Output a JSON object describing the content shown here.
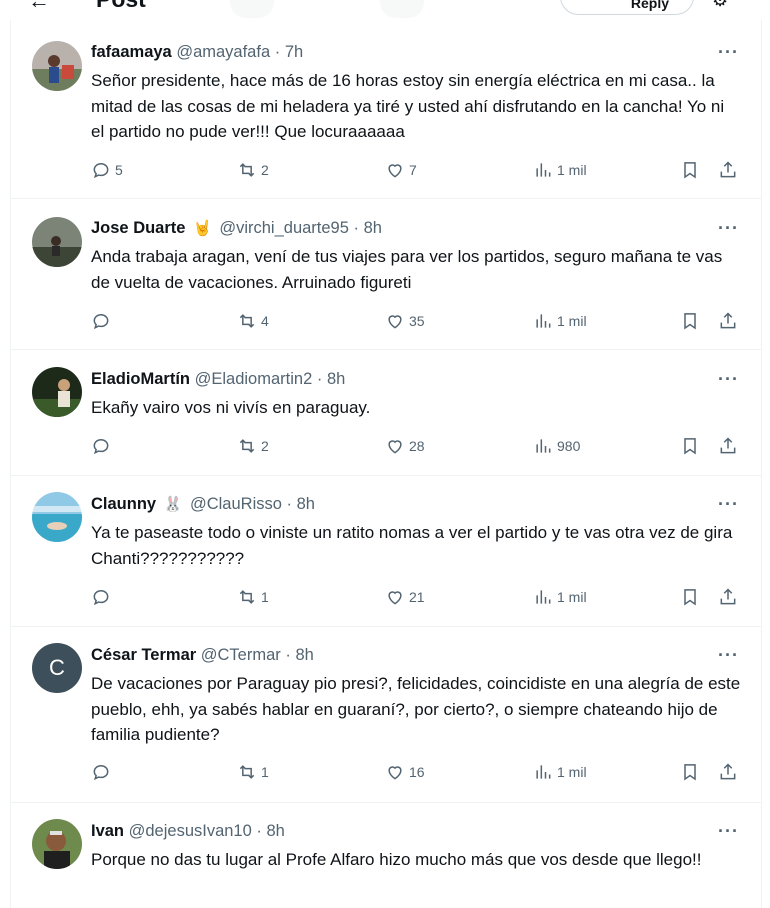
{
  "header": {
    "back_icon": "arrow-left-icon",
    "title": "Post",
    "pill_label": "Reply"
  },
  "replies": [
    {
      "name": "fafaamaya",
      "emoji": "",
      "handle": "@amayafafa",
      "time": "7h",
      "text": "Señor presidente, hace más de 16 horas estoy sin energía eléctrica en mi casa.. la mitad de las cosas de mi heladera ya tiré y usted ahí disfrutando en la cancha! Yo ni el partido no pude ver!!! Que locuraaaaaa",
      "replies": "5",
      "reposts": "2",
      "likes": "7",
      "views": "1 mil"
    },
    {
      "name": "Jose Duarte",
      "emoji": "🤘",
      "handle": "@virchi_duarte95",
      "time": "8h",
      "text": "Anda trabaja aragan, vení de tus viajes para ver los partidos, seguro mañana te vas de vuelta de vacaciones. Arruinado figureti",
      "replies": "",
      "reposts": "4",
      "likes": "35",
      "views": "1 mil"
    },
    {
      "name": "EladioMartín",
      "emoji": "",
      "handle": "@Eladiomartin2",
      "time": "8h",
      "text": "Ekañy vairo vos ni vivís en paraguay.",
      "replies": "",
      "reposts": "2",
      "likes": "28",
      "views": "980"
    },
    {
      "name": "Claunny",
      "emoji": "🐰",
      "handle": "@ClauRisso",
      "time": "8h",
      "text": "Ya te paseaste todo o viniste un ratito nomas a ver el partido y te vas otra vez de gira Chanti???????????",
      "replies": "",
      "reposts": "1",
      "likes": "21",
      "views": "1 mil"
    },
    {
      "name": "César Termar",
      "emoji": "",
      "handle": "@CTermar",
      "time": "8h",
      "avatar_letter": "C",
      "text": "De vacaciones por Paraguay pio presi?, felicidades, coincidiste en una alegría de este pueblo, ehh, ya sabés hablar en guaraní?, por cierto?, o siempre chateando hijo de familia pudiente?",
      "replies": "",
      "reposts": "1",
      "likes": "16",
      "views": "1 mil"
    },
    {
      "name": "Ivan",
      "emoji": "",
      "handle": "@dejesusIvan10",
      "time": "8h",
      "text": "Porque no das tu lugar al Profe Alfaro hizo mucho más que vos desde que llego!!"
    }
  ],
  "separator": "·",
  "more_glyph": "···",
  "colors": {
    "text_primary": "#0f1419",
    "text_secondary": "#536471",
    "border": "#eff3f4"
  }
}
